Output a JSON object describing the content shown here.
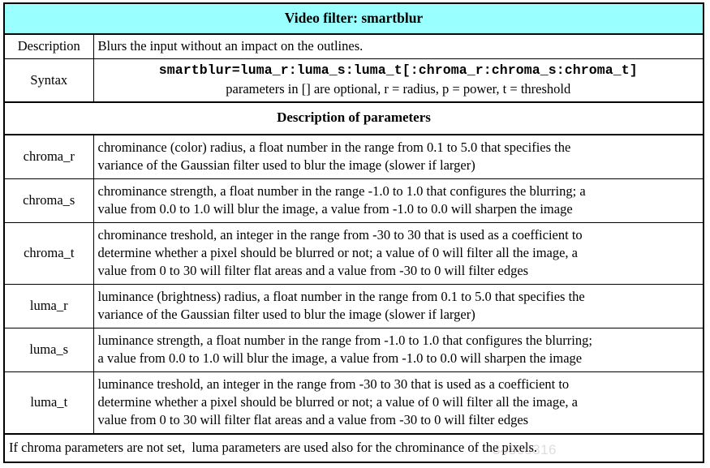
{
  "title": "Video filter: smartblur",
  "rows": {
    "description": {
      "label": "Description",
      "text": "Blurs the input without an impact on the outlines."
    },
    "syntax": {
      "label": "Syntax",
      "code": "smartblur=luma_r:luma_s:luma_t[:chroma_r:chroma_s:chroma_t]",
      "note": "parameters in [] are optional, r = radius, p = power, t = threshold"
    }
  },
  "section_header": "Description of parameters",
  "parameters": [
    {
      "name": "chroma_r",
      "lines": [
        "chrominance (color) radius, a float number in the range from 0.1 to 5.0 that specifies the",
        "variance of the Gaussian filter used to blur the image (slower if larger)"
      ]
    },
    {
      "name": "chroma_s",
      "lines": [
        "chrominance strength, a float number in the range -1.0 to 1.0 that configures the blurring; a",
        "value from 0.0 to 1.0 will blur the image, a value from -1.0 to 0.0 will sharpen the image"
      ]
    },
    {
      "name": "chroma_t",
      "lines": [
        "chrominance treshold, an integer in the range from -30 to 30 that is used as a coefficient to",
        "determine whether a pixel should be blurred or not; a value of 0 will filter all the image, a",
        "value from 0 to 30 will filter flat areas and a value from -30 to 0 will filter edges"
      ]
    },
    {
      "name": "luma_r",
      "lines": [
        "luminance (brightness) radius, a float number in the range from 0.1 to 5.0 that specifies the",
        "variance of the Gaussian filter used to blur the image (slower if larger)"
      ]
    },
    {
      "name": "luma_s",
      "lines": [
        "luminance strength, a float number in the range from -1.0 to 1.0 that configures the blurring;",
        "a value from 0.0 to 1.0 will blur the image, a value from -1.0 to 0.0 will sharpen the image"
      ]
    },
    {
      "name": "luma_t",
      "lines": [
        "luminance treshold, an integer in the range from -30 to 30 that is used as a coefficient to",
        "determine whether a pixel should be blurred or not; a value of 0 will filter all the image, a",
        "value from 0 to 30 will filter flat areas and a value from -30 to 0 will filter edges"
      ]
    }
  ],
  "footer": "If chroma parameters are not set,  luma parameters are used also for the chrominance of the pixels.",
  "watermark": "34305316",
  "colors": {
    "title_background": "#99ffff",
    "border": "#000000",
    "text": "#000000",
    "page_background": "#ffffff"
  }
}
